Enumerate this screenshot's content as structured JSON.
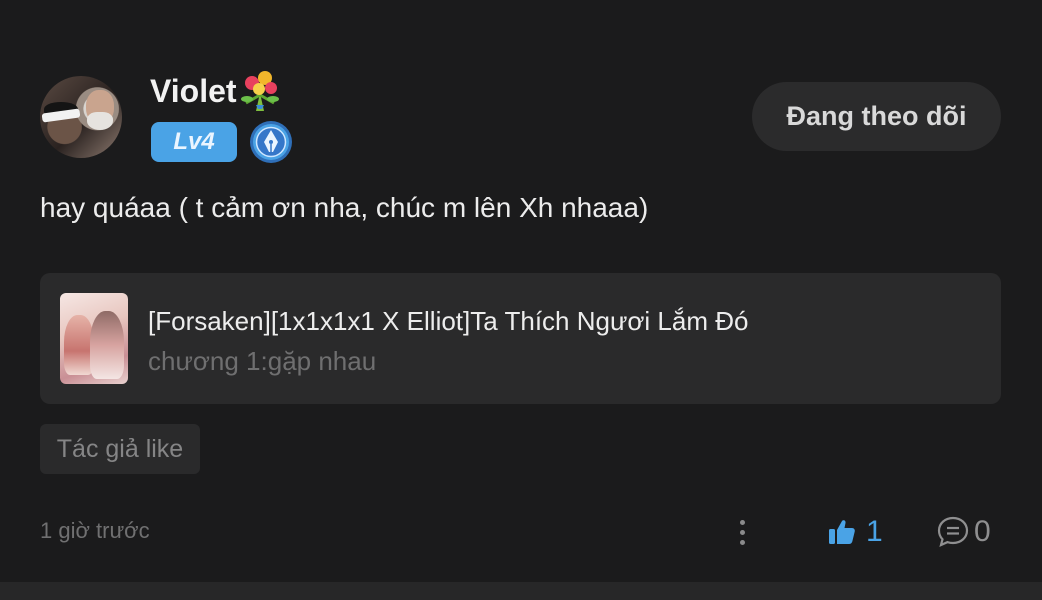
{
  "comment": {
    "user": {
      "name": "Violet",
      "level": "Lv4"
    },
    "follow_label": "Đang theo dõi",
    "text": "hay quáaa ( t cảm ơn nha, chúc m lên Xh nhaaa)",
    "story": {
      "title": "[Forsaken][1x1x1x1 X Elliot]Ta Thích Ngươi Lắm Đó",
      "chapter": "chương 1:gặp nhau"
    },
    "author_like_label": "Tác giả like",
    "timestamp": "1 giờ trước",
    "like_count": "1",
    "reply_count": "0"
  },
  "colors": {
    "background": "#1b1b1c",
    "card": "#2a2a2b",
    "accent": "#4aa3e6",
    "muted_text": "#707071"
  },
  "icons": {
    "bouquet": "flower-bouquet-icon",
    "badge": "pen-nib-badge-icon",
    "like": "thumbs-up-icon",
    "reply": "speech-bubble-icon",
    "more": "vertical-dots-icon"
  }
}
